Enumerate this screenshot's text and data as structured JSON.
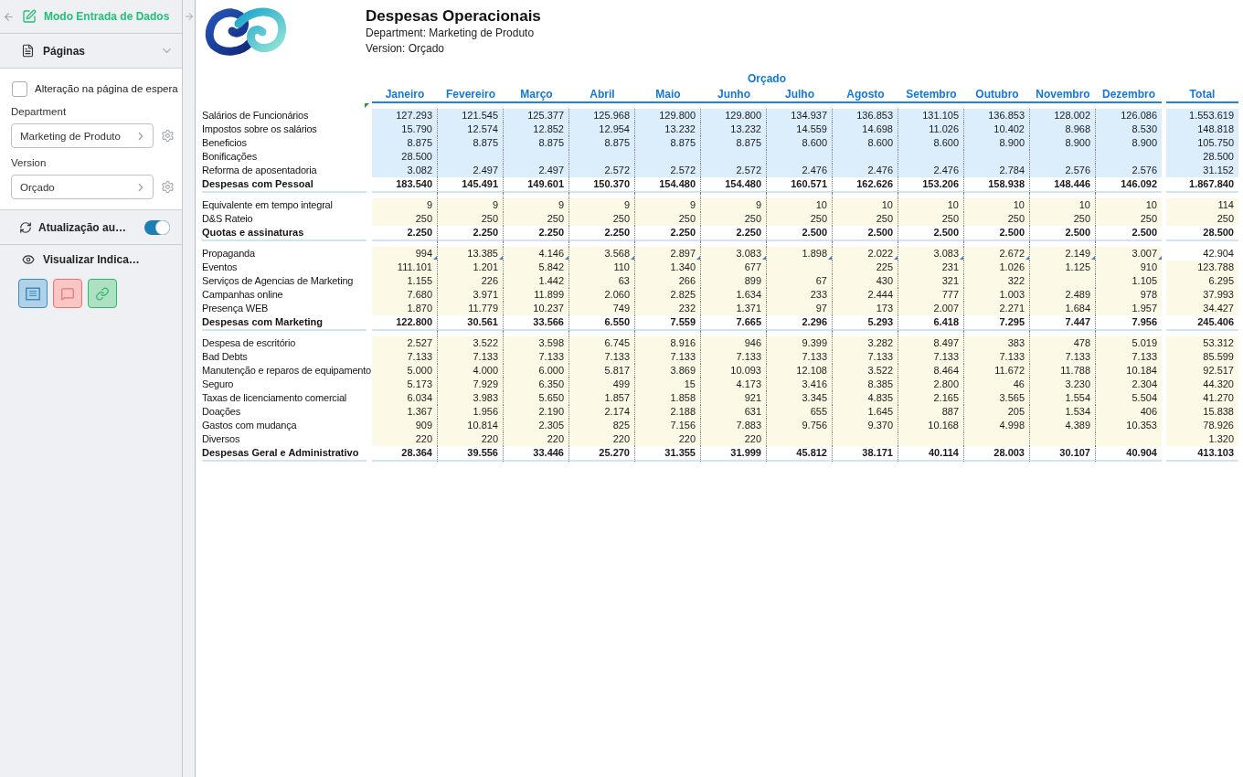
{
  "sidebar": {
    "mode_title": "Modo Entrada de Dados",
    "pages_section": {
      "title": "Páginas",
      "expanded": true
    },
    "hold_page_change": {
      "label": "Alteração na página de espera",
      "checked": false
    },
    "filters": [
      {
        "label": "Department",
        "value": "Marketing de Produto"
      },
      {
        "label": "Version",
        "value": "Orçado"
      }
    ],
    "auto_refresh": {
      "label": "Atualização au…",
      "on": true
    },
    "indicators": {
      "label": "Visualizar Indica…",
      "buttons": [
        {
          "kind": "notes",
          "color": "#3a8cc0"
        },
        {
          "kind": "comments",
          "color": "#ef7070"
        },
        {
          "kind": "links",
          "color": "#34b36b"
        }
      ]
    }
  },
  "report": {
    "title": "Despesas Operacionais",
    "subtitle_lines": [
      "Department: Marketing de Produto",
      "Version: Orçado"
    ],
    "column_group": "Orçado",
    "months": [
      "Janeiro",
      "Fevereiro",
      "Março",
      "Abril",
      "Maio",
      "Junho",
      "Julho",
      "Agosto",
      "Setembro",
      "Outubro",
      "Novembro",
      "Dezembro"
    ],
    "total_header": "Total",
    "groups": [
      {
        "color": "#dcedfb",
        "rows": [
          {
            "kind": "item",
            "label": "Salários de Funcionários",
            "cells": [
              {
                "kind": "amount",
                "text": "127.293"
              },
              {
                "kind": "amount",
                "text": "121.545"
              },
              {
                "kind": "amount",
                "text": "125.377"
              },
              {
                "kind": "amount",
                "text": "125.968"
              },
              {
                "kind": "amount",
                "text": "129.800"
              },
              {
                "kind": "amount",
                "text": "129.800"
              },
              {
                "kind": "amount",
                "text": "134.937"
              },
              {
                "kind": "amount",
                "text": "136.853"
              },
              {
                "kind": "amount",
                "text": "131.105"
              },
              {
                "kind": "amount",
                "text": "136.853"
              },
              {
                "kind": "amount",
                "text": "128.002"
              },
              {
                "kind": "amount",
                "text": "126.086"
              }
            ],
            "total": "1.553.619",
            "total_shaded": true,
            "notes": false
          },
          {
            "kind": "item",
            "label": "Impostos sobre os salários",
            "cells": [
              {
                "kind": "amount",
                "text": "15.790"
              },
              {
                "kind": "amount",
                "text": "12.574"
              },
              {
                "kind": "amount",
                "text": "12.852"
              },
              {
                "kind": "amount",
                "text": "12.954"
              },
              {
                "kind": "amount",
                "text": "13.232"
              },
              {
                "kind": "amount",
                "text": "13.232"
              },
              {
                "kind": "amount",
                "text": "14.559"
              },
              {
                "kind": "amount",
                "text": "14.698"
              },
              {
                "kind": "amount",
                "text": "11.026"
              },
              {
                "kind": "amount",
                "text": "10.402"
              },
              {
                "kind": "amount",
                "text": "8.968"
              },
              {
                "kind": "amount",
                "text": "8.530"
              }
            ],
            "total": "148.818",
            "total_shaded": true,
            "notes": false
          },
          {
            "kind": "item",
            "label": "Beneficios",
            "cells": [
              {
                "kind": "amount",
                "text": "8.875"
              },
              {
                "kind": "amount",
                "text": "8.875"
              },
              {
                "kind": "amount",
                "text": "8.875"
              },
              {
                "kind": "amount",
                "text": "8.875"
              },
              {
                "kind": "amount",
                "text": "8.875"
              },
              {
                "kind": "amount",
                "text": "8.875"
              },
              {
                "kind": "amount",
                "text": "8.600"
              },
              {
                "kind": "amount",
                "text": "8.600"
              },
              {
                "kind": "amount",
                "text": "8.600"
              },
              {
                "kind": "amount",
                "text": "8.900"
              },
              {
                "kind": "amount",
                "text": "8.900"
              },
              {
                "kind": "amount",
                "text": "8.900"
              }
            ],
            "total": "105.750",
            "total_shaded": true,
            "notes": false
          },
          {
            "kind": "item",
            "label": "Bonificações",
            "cells": [
              {
                "kind": "amount",
                "text": "28.500"
              },
              {
                "kind": "blank"
              },
              {
                "kind": "blank"
              },
              {
                "kind": "blank"
              },
              {
                "kind": "blank"
              },
              {
                "kind": "blank"
              },
              {
                "kind": "blank"
              },
              {
                "kind": "blank"
              },
              {
                "kind": "blank"
              },
              {
                "kind": "blank"
              },
              {
                "kind": "blank"
              },
              {
                "kind": "blank"
              }
            ],
            "total": "28.500",
            "total_shaded": true,
            "notes": false
          },
          {
            "kind": "item",
            "label": "Reforma de aposentadoria",
            "cells": [
              {
                "kind": "amount",
                "text": "3.082"
              },
              {
                "kind": "amount",
                "text": "2.497"
              },
              {
                "kind": "amount",
                "text": "2.497"
              },
              {
                "kind": "amount",
                "text": "2.572"
              },
              {
                "kind": "amount",
                "text": "2.572"
              },
              {
                "kind": "amount",
                "text": "2.572"
              },
              {
                "kind": "amount",
                "text": "2.476"
              },
              {
                "kind": "amount",
                "text": "2.476"
              },
              {
                "kind": "amount",
                "text": "2.476"
              },
              {
                "kind": "amount",
                "text": "2.784"
              },
              {
                "kind": "amount",
                "text": "2.576"
              },
              {
                "kind": "amount",
                "text": "2.576"
              }
            ],
            "total": "31.152",
            "total_shaded": true,
            "notes": false
          },
          {
            "kind": "subtotal",
            "label": "Despesas com Pessoal",
            "cells": [
              {
                "kind": "amount",
                "text": "183.540"
              },
              {
                "kind": "amount",
                "text": "145.491"
              },
              {
                "kind": "amount",
                "text": "149.601"
              },
              {
                "kind": "amount",
                "text": "150.370"
              },
              {
                "kind": "amount",
                "text": "154.480"
              },
              {
                "kind": "amount",
                "text": "154.480"
              },
              {
                "kind": "amount",
                "text": "160.571"
              },
              {
                "kind": "amount",
                "text": "162.626"
              },
              {
                "kind": "amount",
                "text": "153.206"
              },
              {
                "kind": "amount",
                "text": "158.938"
              },
              {
                "kind": "amount",
                "text": "148.446"
              },
              {
                "kind": "amount",
                "text": "146.092"
              }
            ],
            "total": "1.867.840",
            "total_shaded": false,
            "notes": false
          }
        ]
      },
      {
        "color": "#fcfae6",
        "rows": [
          {
            "kind": "item",
            "label": "Equivalente em tempo integral",
            "cells": [
              {
                "kind": "amount",
                "text": "9"
              },
              {
                "kind": "amount",
                "text": "9"
              },
              {
                "kind": "amount",
                "text": "9"
              },
              {
                "kind": "amount",
                "text": "9"
              },
              {
                "kind": "amount",
                "text": "9"
              },
              {
                "kind": "amount",
                "text": "9"
              },
              {
                "kind": "amount",
                "text": "10"
              },
              {
                "kind": "amount",
                "text": "10"
              },
              {
                "kind": "amount",
                "text": "10"
              },
              {
                "kind": "amount",
                "text": "10"
              },
              {
                "kind": "amount",
                "text": "10"
              },
              {
                "kind": "amount",
                "text": "10"
              }
            ],
            "total": "114",
            "total_shaded": true,
            "notes": false
          },
          {
            "kind": "item",
            "label": "D&S Rateio",
            "cells": [
              {
                "kind": "amount",
                "text": "250"
              },
              {
                "kind": "amount",
                "text": "250"
              },
              {
                "kind": "amount",
                "text": "250"
              },
              {
                "kind": "amount",
                "text": "250"
              },
              {
                "kind": "amount",
                "text": "250"
              },
              {
                "kind": "amount",
                "text": "250"
              },
              {
                "kind": "amount",
                "text": "250"
              },
              {
                "kind": "amount",
                "text": "250"
              },
              {
                "kind": "amount",
                "text": "250"
              },
              {
                "kind": "amount",
                "text": "250"
              },
              {
                "kind": "amount",
                "text": "250"
              },
              {
                "kind": "amount",
                "text": "250"
              }
            ],
            "total": "250",
            "total_shaded": true,
            "notes": false
          },
          {
            "kind": "subtotal",
            "label": "Quotas e assinaturas",
            "cells": [
              {
                "kind": "amount",
                "text": "2.250"
              },
              {
                "kind": "amount",
                "text": "2.250"
              },
              {
                "kind": "amount",
                "text": "2.250"
              },
              {
                "kind": "amount",
                "text": "2.250"
              },
              {
                "kind": "amount",
                "text": "2.250"
              },
              {
                "kind": "amount",
                "text": "2.250"
              },
              {
                "kind": "amount",
                "text": "2.500"
              },
              {
                "kind": "amount",
                "text": "2.500"
              },
              {
                "kind": "amount",
                "text": "2.500"
              },
              {
                "kind": "amount",
                "text": "2.500"
              },
              {
                "kind": "amount",
                "text": "2.500"
              },
              {
                "kind": "amount",
                "text": "2.500"
              }
            ],
            "total": "28.500",
            "total_shaded": false,
            "notes": false
          }
        ]
      },
      {
        "color": "#fcfae6",
        "rows": [
          {
            "kind": "item",
            "label": "Propaganda",
            "cells": [
              {
                "kind": "amount",
                "text": "994"
              },
              {
                "kind": "amount",
                "text": "13.385"
              },
              {
                "kind": "amount",
                "text": "4.146"
              },
              {
                "kind": "amount",
                "text": "3.568"
              },
              {
                "kind": "amount",
                "text": "2.897"
              },
              {
                "kind": "amount",
                "text": "3.083"
              },
              {
                "kind": "amount",
                "text": "1.898"
              },
              {
                "kind": "amount",
                "text": "2.022"
              },
              {
                "kind": "amount",
                "text": "3.083"
              },
              {
                "kind": "amount",
                "text": "2.672"
              },
              {
                "kind": "amount",
                "text": "2.149"
              },
              {
                "kind": "amount",
                "text": "3.007"
              }
            ],
            "total": "42.904",
            "total_shaded": false,
            "notes": true
          },
          {
            "kind": "item",
            "label": "Eventos",
            "cells": [
              {
                "kind": "amount",
                "text": "111.101"
              },
              {
                "kind": "amount",
                "text": "1.201"
              },
              {
                "kind": "amount",
                "text": "5.842"
              },
              {
                "kind": "amount",
                "text": "110"
              },
              {
                "kind": "amount",
                "text": "1.340"
              },
              {
                "kind": "amount",
                "text": "677"
              },
              {
                "kind": "blank"
              },
              {
                "kind": "amount",
                "text": "225"
              },
              {
                "kind": "amount",
                "text": "231"
              },
              {
                "kind": "amount",
                "text": "1.026"
              },
              {
                "kind": "amount",
                "text": "1.125"
              },
              {
                "kind": "amount",
                "text": "910"
              }
            ],
            "total": "123.788",
            "total_shaded": true,
            "notes": false
          },
          {
            "kind": "item",
            "label": "Serviços de Agencias de Marketing",
            "cells": [
              {
                "kind": "amount",
                "text": "1.155"
              },
              {
                "kind": "amount",
                "text": "226"
              },
              {
                "kind": "amount",
                "text": "1.442"
              },
              {
                "kind": "amount",
                "text": "63"
              },
              {
                "kind": "amount",
                "text": "266"
              },
              {
                "kind": "amount",
                "text": "899"
              },
              {
                "kind": "amount",
                "text": "67"
              },
              {
                "kind": "amount",
                "text": "430"
              },
              {
                "kind": "amount",
                "text": "321"
              },
              {
                "kind": "amount",
                "text": "322"
              },
              {
                "kind": "blank"
              },
              {
                "kind": "amount",
                "text": "1.105"
              }
            ],
            "total": "6.295",
            "total_shaded": true,
            "notes": false
          },
          {
            "kind": "item",
            "label": "Campanhas online",
            "cells": [
              {
                "kind": "amount",
                "text": "7.680"
              },
              {
                "kind": "amount",
                "text": "3.971"
              },
              {
                "kind": "amount",
                "text": "11.899"
              },
              {
                "kind": "amount",
                "text": "2.060"
              },
              {
                "kind": "amount",
                "text": "2.825"
              },
              {
                "kind": "amount",
                "text": "1.634"
              },
              {
                "kind": "amount",
                "text": "233"
              },
              {
                "kind": "amount",
                "text": "2.444"
              },
              {
                "kind": "amount",
                "text": "777"
              },
              {
                "kind": "amount",
                "text": "1.003"
              },
              {
                "kind": "amount",
                "text": "2.489"
              },
              {
                "kind": "amount",
                "text": "978"
              }
            ],
            "total": "37.993",
            "total_shaded": true,
            "notes": false
          },
          {
            "kind": "item",
            "label": "Presença WEB",
            "cells": [
              {
                "kind": "amount",
                "text": "1.870"
              },
              {
                "kind": "amount",
                "text": "11.779"
              },
              {
                "kind": "amount",
                "text": "10.237"
              },
              {
                "kind": "amount",
                "text": "749"
              },
              {
                "kind": "amount",
                "text": "232"
              },
              {
                "kind": "amount",
                "text": "1.371"
              },
              {
                "kind": "amount",
                "text": "97"
              },
              {
                "kind": "amount",
                "text": "173"
              },
              {
                "kind": "amount",
                "text": "2.007"
              },
              {
                "kind": "amount",
                "text": "2.271"
              },
              {
                "kind": "amount",
                "text": "1.684"
              },
              {
                "kind": "amount",
                "text": "1.957"
              }
            ],
            "total": "34.427",
            "total_shaded": true,
            "notes": false
          },
          {
            "kind": "subtotal",
            "label": "Despesas com Marketing",
            "cells": [
              {
                "kind": "amount",
                "text": "122.800"
              },
              {
                "kind": "amount",
                "text": "30.561"
              },
              {
                "kind": "amount",
                "text": "33.566"
              },
              {
                "kind": "amount",
                "text": "6.550"
              },
              {
                "kind": "amount",
                "text": "7.559"
              },
              {
                "kind": "amount",
                "text": "7.665"
              },
              {
                "kind": "amount",
                "text": "2.296"
              },
              {
                "kind": "amount",
                "text": "5.293"
              },
              {
                "kind": "amount",
                "text": "6.418"
              },
              {
                "kind": "amount",
                "text": "7.295"
              },
              {
                "kind": "amount",
                "text": "7.447"
              },
              {
                "kind": "amount",
                "text": "7.956"
              }
            ],
            "total": "245.406",
            "total_shaded": false,
            "notes": false
          }
        ]
      },
      {
        "color": "#fcfae6",
        "rows": [
          {
            "kind": "item",
            "label": "Despesa de escritório",
            "cells": [
              {
                "kind": "amount",
                "text": "2.527"
              },
              {
                "kind": "amount",
                "text": "3.522"
              },
              {
                "kind": "amount",
                "text": "3.598"
              },
              {
                "kind": "amount",
                "text": "6.745"
              },
              {
                "kind": "amount",
                "text": "8.916"
              },
              {
                "kind": "amount",
                "text": "946"
              },
              {
                "kind": "amount",
                "text": "9.399"
              },
              {
                "kind": "amount",
                "text": "3.282"
              },
              {
                "kind": "amount",
                "text": "8.497"
              },
              {
                "kind": "amount",
                "text": "383"
              },
              {
                "kind": "amount",
                "text": "478"
              },
              {
                "kind": "amount",
                "text": "5.019"
              }
            ],
            "total": "53.312",
            "total_shaded": true,
            "notes": false
          },
          {
            "kind": "item",
            "label": "Bad Debts",
            "cells": [
              {
                "kind": "amount",
                "text": "7.133"
              },
              {
                "kind": "amount",
                "text": "7.133"
              },
              {
                "kind": "amount",
                "text": "7.133"
              },
              {
                "kind": "amount",
                "text": "7.133"
              },
              {
                "kind": "amount",
                "text": "7.133"
              },
              {
                "kind": "amount",
                "text": "7.133"
              },
              {
                "kind": "amount",
                "text": "7.133"
              },
              {
                "kind": "amount",
                "text": "7.133"
              },
              {
                "kind": "amount",
                "text": "7.133"
              },
              {
                "kind": "amount",
                "text": "7.133"
              },
              {
                "kind": "amount",
                "text": "7.133"
              },
              {
                "kind": "amount",
                "text": "7.133"
              }
            ],
            "total": "85.599",
            "total_shaded": true,
            "notes": false
          },
          {
            "kind": "item",
            "label": "Manutenção e reparos de equipamento",
            "cells": [
              {
                "kind": "amount",
                "text": "5.000"
              },
              {
                "kind": "amount",
                "text": "4.000"
              },
              {
                "kind": "amount",
                "text": "6.000"
              },
              {
                "kind": "amount",
                "text": "5.817"
              },
              {
                "kind": "amount",
                "text": "3.869"
              },
              {
                "kind": "amount",
                "text": "10.093"
              },
              {
                "kind": "amount",
                "text": "12.108"
              },
              {
                "kind": "amount",
                "text": "3.522"
              },
              {
                "kind": "amount",
                "text": "8.464"
              },
              {
                "kind": "amount",
                "text": "11.672"
              },
              {
                "kind": "amount",
                "text": "11.788"
              },
              {
                "kind": "amount",
                "text": "10.184"
              }
            ],
            "total": "92.517",
            "total_shaded": true,
            "notes": false
          },
          {
            "kind": "item",
            "label": "Seguro",
            "cells": [
              {
                "kind": "amount",
                "text": "5.173"
              },
              {
                "kind": "amount",
                "text": "7.929"
              },
              {
                "kind": "amount",
                "text": "6.350"
              },
              {
                "kind": "amount",
                "text": "499"
              },
              {
                "kind": "amount",
                "text": "15"
              },
              {
                "kind": "amount",
                "text": "4.173"
              },
              {
                "kind": "amount",
                "text": "3.416"
              },
              {
                "kind": "amount",
                "text": "8.385"
              },
              {
                "kind": "amount",
                "text": "2.800"
              },
              {
                "kind": "amount",
                "text": "46"
              },
              {
                "kind": "amount",
                "text": "3.230"
              },
              {
                "kind": "amount",
                "text": "2.304"
              }
            ],
            "total": "44.320",
            "total_shaded": true,
            "notes": false
          },
          {
            "kind": "item",
            "label": "Taxas de licenciamento comercial",
            "cells": [
              {
                "kind": "amount",
                "text": "6.034"
              },
              {
                "kind": "amount",
                "text": "3.983"
              },
              {
                "kind": "amount",
                "text": "5.650"
              },
              {
                "kind": "amount",
                "text": "1.857"
              },
              {
                "kind": "amount",
                "text": "1.858"
              },
              {
                "kind": "amount",
                "text": "921"
              },
              {
                "kind": "amount",
                "text": "3.345"
              },
              {
                "kind": "amount",
                "text": "4.835"
              },
              {
                "kind": "amount",
                "text": "2.165"
              },
              {
                "kind": "amount",
                "text": "3.565"
              },
              {
                "kind": "amount",
                "text": "1.554"
              },
              {
                "kind": "amount",
                "text": "5.504"
              }
            ],
            "total": "41.270",
            "total_shaded": true,
            "notes": false
          },
          {
            "kind": "item",
            "label": "Doações",
            "cells": [
              {
                "kind": "amount",
                "text": "1.367"
              },
              {
                "kind": "amount",
                "text": "1.956"
              },
              {
                "kind": "amount",
                "text": "2.190"
              },
              {
                "kind": "amount",
                "text": "2.174"
              },
              {
                "kind": "amount",
                "text": "2.188"
              },
              {
                "kind": "amount",
                "text": "631"
              },
              {
                "kind": "amount",
                "text": "655"
              },
              {
                "kind": "amount",
                "text": "1.645"
              },
              {
                "kind": "amount",
                "text": "887"
              },
              {
                "kind": "amount",
                "text": "205"
              },
              {
                "kind": "amount",
                "text": "1.534"
              },
              {
                "kind": "amount",
                "text": "406"
              }
            ],
            "total": "15.838",
            "total_shaded": true,
            "notes": false
          },
          {
            "kind": "item",
            "label": "Gastos com mudança",
            "cells": [
              {
                "kind": "amount",
                "text": "909"
              },
              {
                "kind": "amount",
                "text": "10.814"
              },
              {
                "kind": "amount",
                "text": "2.305"
              },
              {
                "kind": "amount",
                "text": "825"
              },
              {
                "kind": "amount",
                "text": "7.156"
              },
              {
                "kind": "amount",
                "text": "7.883"
              },
              {
                "kind": "amount",
                "text": "9.756"
              },
              {
                "kind": "amount",
                "text": "9.370"
              },
              {
                "kind": "amount",
                "text": "10.168"
              },
              {
                "kind": "amount",
                "text": "4.998"
              },
              {
                "kind": "amount",
                "text": "4.389"
              },
              {
                "kind": "amount",
                "text": "10.353"
              }
            ],
            "total": "78.926",
            "total_shaded": true,
            "notes": false
          },
          {
            "kind": "item",
            "label": "Diversos",
            "cells": [
              {
                "kind": "amount",
                "text": "220"
              },
              {
                "kind": "amount",
                "text": "220"
              },
              {
                "kind": "amount",
                "text": "220"
              },
              {
                "kind": "amount",
                "text": "220"
              },
              {
                "kind": "amount",
                "text": "220"
              },
              {
                "kind": "amount",
                "text": "220"
              },
              {
                "kind": "blank"
              },
              {
                "kind": "blank"
              },
              {
                "kind": "blank"
              },
              {
                "kind": "blank"
              },
              {
                "kind": "blank"
              },
              {
                "kind": "blank"
              }
            ],
            "total": "1.320",
            "total_shaded": true,
            "notes": false
          },
          {
            "kind": "subtotal",
            "label": "Despesas Geral e Administrativo",
            "cells": [
              {
                "kind": "amount",
                "text": "28.364"
              },
              {
                "kind": "amount",
                "text": "39.556"
              },
              {
                "kind": "amount",
                "text": "33.446"
              },
              {
                "kind": "amount",
                "text": "25.270"
              },
              {
                "kind": "amount",
                "text": "31.355"
              },
              {
                "kind": "amount",
                "text": "31.999"
              },
              {
                "kind": "amount",
                "text": "45.812"
              },
              {
                "kind": "amount",
                "text": "38.171"
              },
              {
                "kind": "amount",
                "text": "40.114"
              },
              {
                "kind": "amount",
                "text": "28.003"
              },
              {
                "kind": "amount",
                "text": "30.107"
              },
              {
                "kind": "amount",
                "text": "40.904"
              }
            ],
            "total": "413.103",
            "total_shaded": false,
            "notes": false
          }
        ]
      }
    ]
  }
}
